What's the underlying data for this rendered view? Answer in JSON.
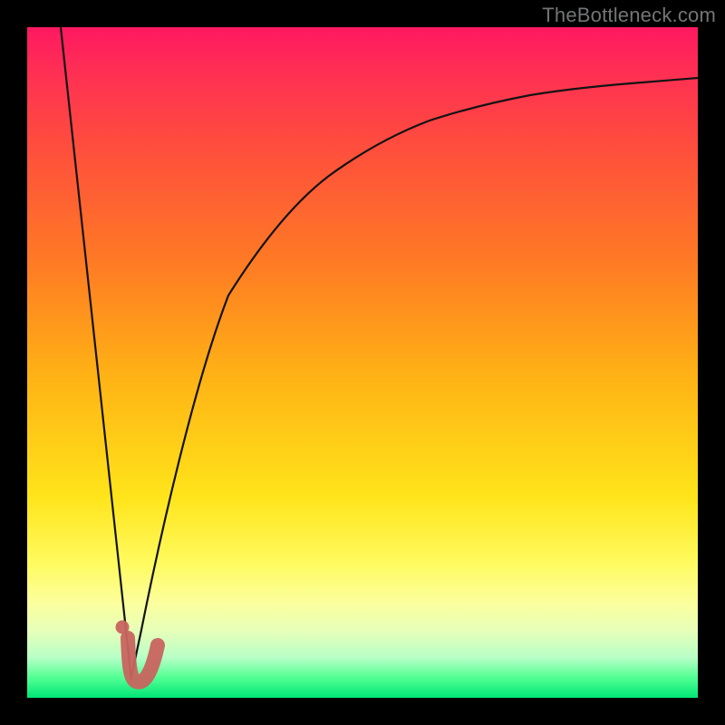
{
  "watermark": "TheBottleneck.com",
  "colors": {
    "frame": "#000000",
    "curve_stroke": "#131313",
    "marker_stroke": "#c8645f",
    "marker_fill": "#c8645f",
    "watermark_text": "#737576"
  },
  "chart_data": {
    "type": "line",
    "title": "",
    "xlabel": "",
    "ylabel": "",
    "xlim": [
      0,
      100
    ],
    "ylim": [
      0,
      100
    ],
    "grid": false,
    "legend": false,
    "series": [
      {
        "name": "left-branch",
        "x": [
          5,
          15.5
        ],
        "y": [
          100,
          3
        ],
        "style": "line"
      },
      {
        "name": "right-branch",
        "x": [
          15.5,
          17,
          20,
          25,
          30,
          35,
          40,
          45,
          50,
          55,
          60,
          65,
          70,
          75,
          80,
          85,
          90,
          95,
          100
        ],
        "y": [
          3,
          10,
          25,
          47,
          60,
          68,
          74,
          78,
          81.5,
          84,
          86,
          87.5,
          88.7,
          89.7,
          90.5,
          91.1,
          91.6,
          92,
          92.4
        ],
        "style": "curve"
      },
      {
        "name": "optimum-marker-hook",
        "x": [
          15,
          15.5,
          16,
          17.5,
          19,
          19.5
        ],
        "y": [
          9,
          5,
          2.5,
          2.2,
          4.5,
          8
        ],
        "style": "thick-curve"
      },
      {
        "name": "optimum-marker-dot",
        "x": [
          14.2
        ],
        "y": [
          10.5
        ],
        "style": "point"
      }
    ],
    "annotations": []
  }
}
